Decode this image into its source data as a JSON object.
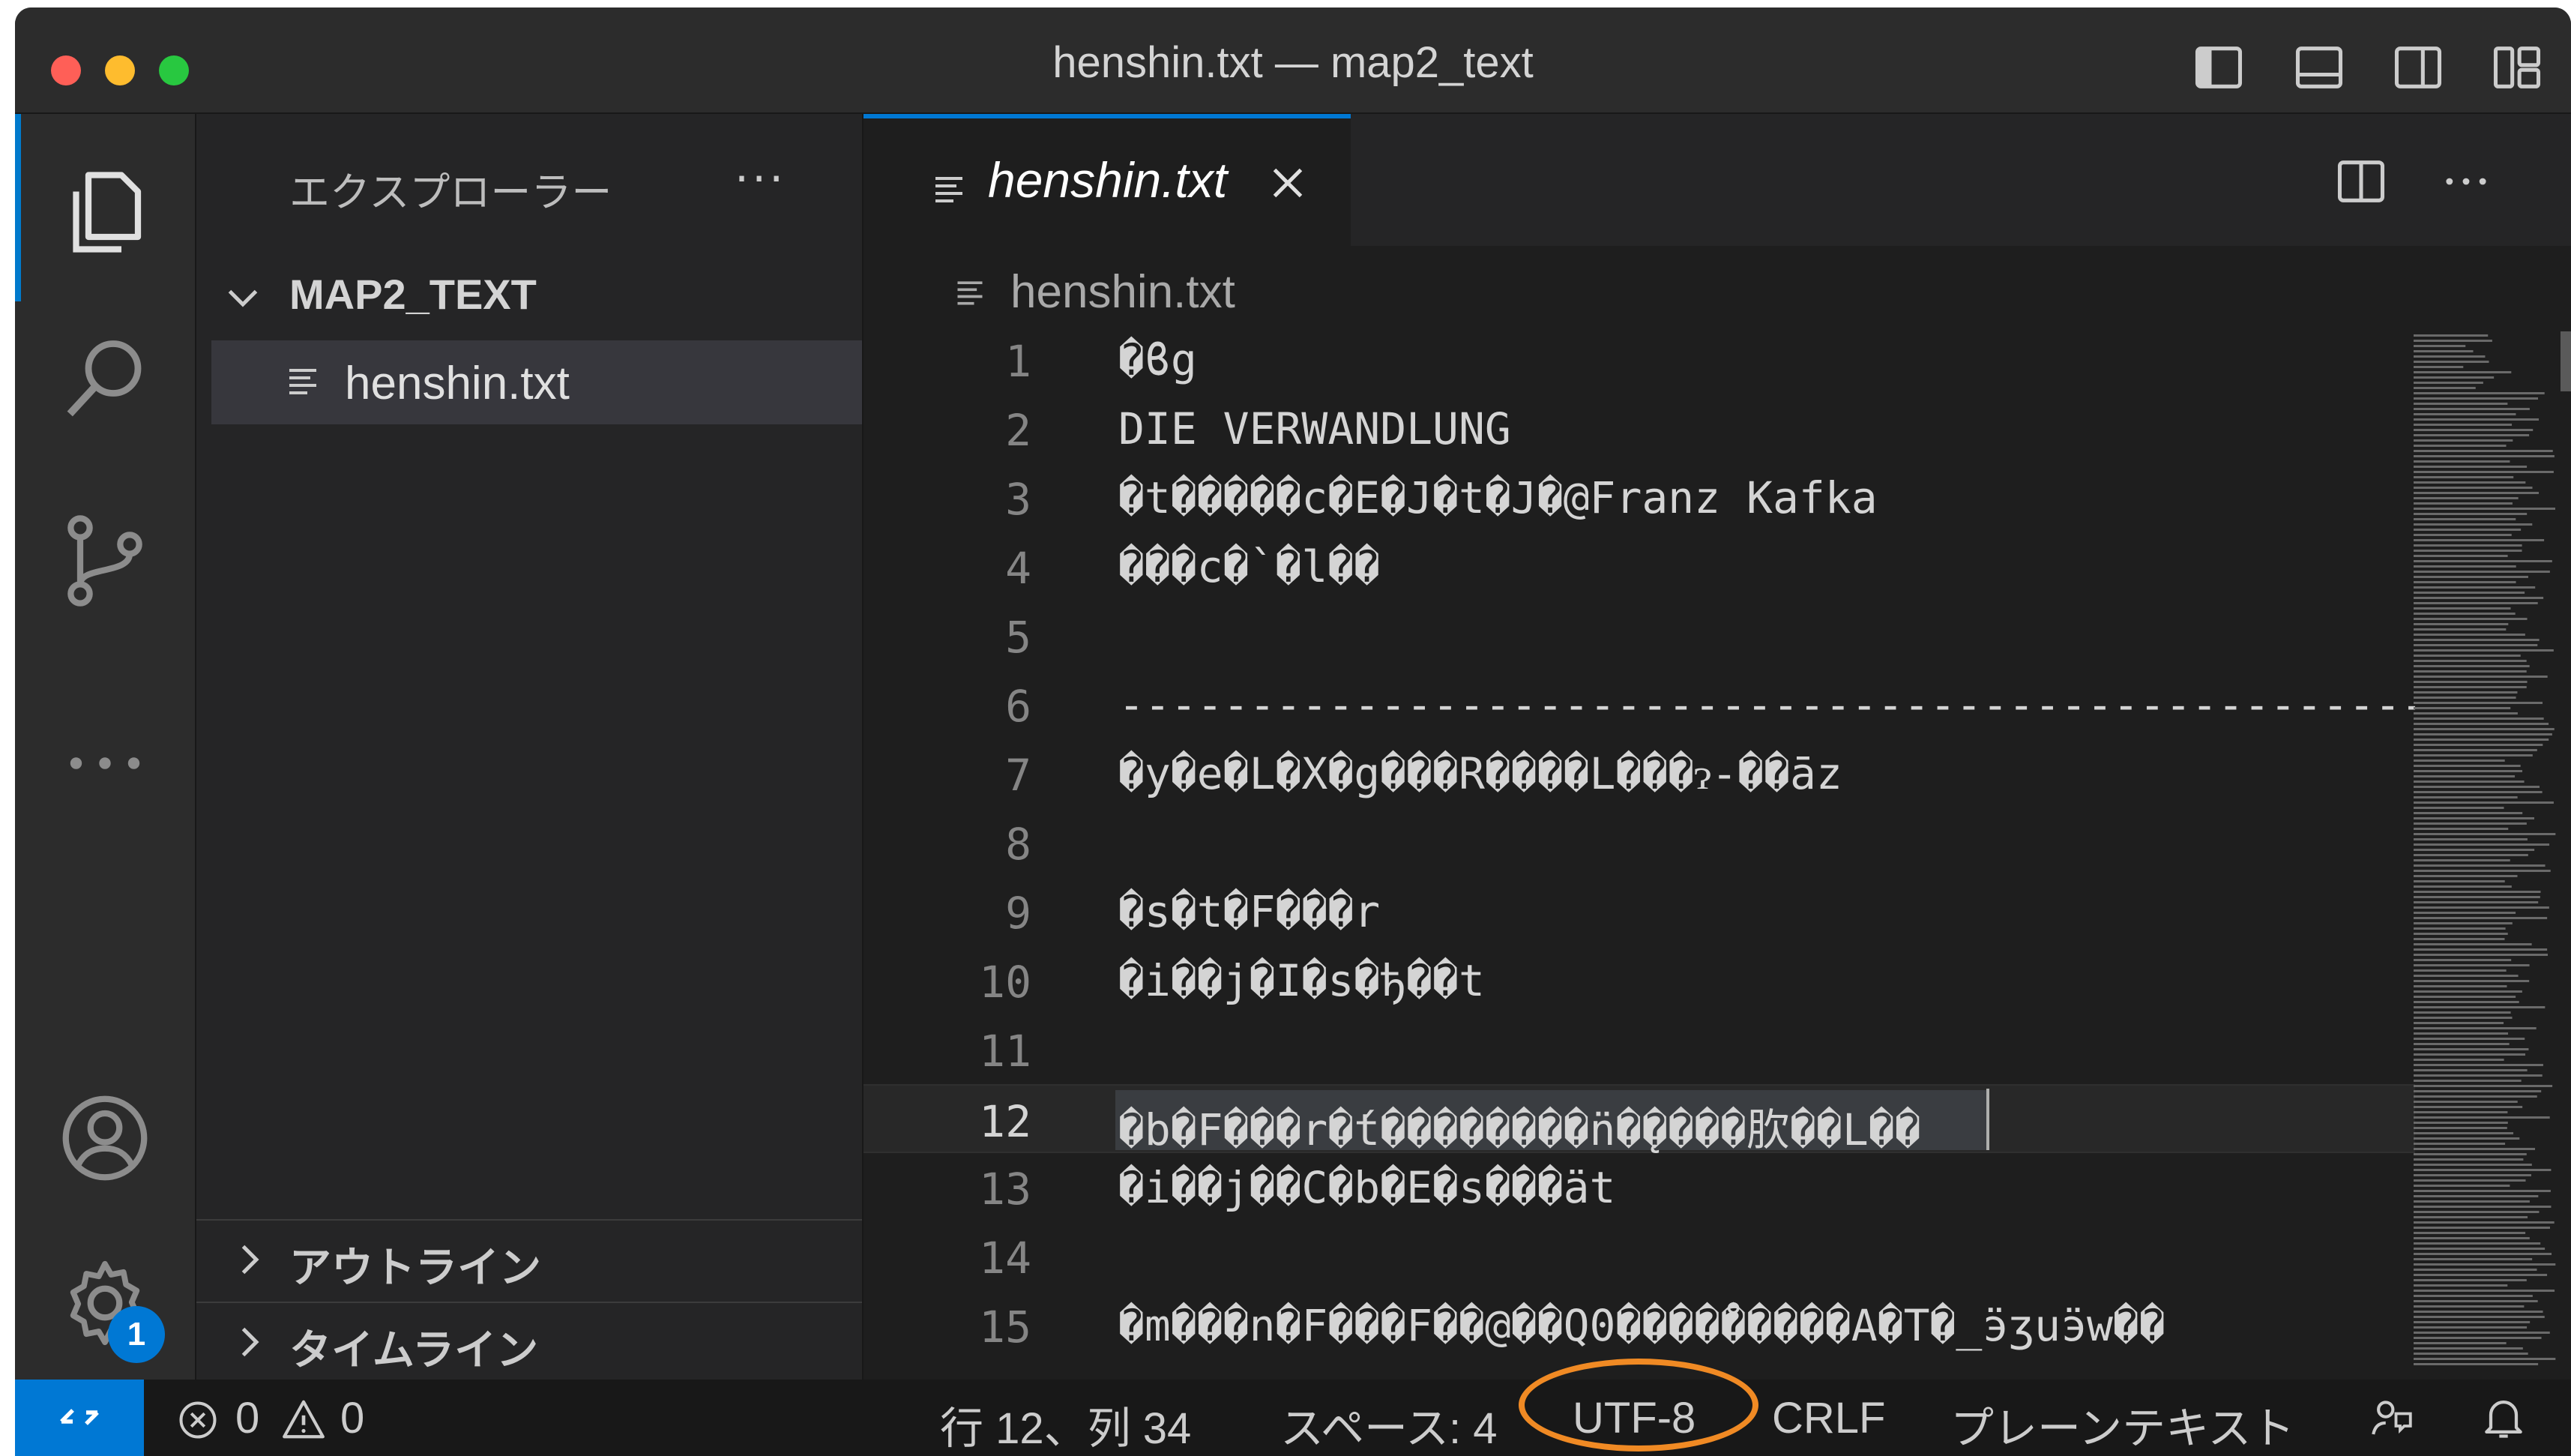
{
  "window": {
    "title": "henshin.txt — map2_text"
  },
  "sidebar": {
    "title": "エクスプローラー",
    "more_label": "···",
    "folder": "MAP2_TEXT",
    "file": "henshin.txt",
    "panels": [
      {
        "label": "アウトライン"
      },
      {
        "label": "タイムライン"
      }
    ]
  },
  "activity": {
    "settings_badge": "1"
  },
  "editor": {
    "tab_label": "henshin.txt",
    "breadcrumb": "henshin.txt",
    "current_line": 12,
    "lines": [
      {
        "n": "1",
        "text": "�ϐg"
      },
      {
        "n": "2",
        "text": "DIE VERWANDLUNG"
      },
      {
        "n": "3",
        "text": "�t�����c�E�J�t�J�@Franz Kafka"
      },
      {
        "n": "4",
        "text": "���c�`�l��"
      },
      {
        "n": "5",
        "text": ""
      },
      {
        "n": "6",
        "text": "-----------------------------------------------------------"
      },
      {
        "n": "7",
        "text": "�y�e�L�X�g���R����L���ɂ-��āz"
      },
      {
        "n": "8",
        "text": ""
      },
      {
        "n": "9",
        "text": "�s�t�F���r"
      },
      {
        "n": "10",
        "text": "�i��j�I�s�ђ��t"
      },
      {
        "n": "11",
        "text": ""
      },
      {
        "n": "12",
        "text": "�b�F���r�́t��������̈n�̨����肷��L��"
      },
      {
        "n": "13",
        "text": "�i��j��C�b�E�s���ät"
      },
      {
        "n": "14",
        "text": ""
      },
      {
        "n": "15",
        "text": "�m���n�F���F��@��Q0����̊�����A�T�_ӭʒuӭw��"
      }
    ]
  },
  "statusbar": {
    "errors": "0",
    "warnings": "0",
    "position": "行 12、列 34",
    "indent": "スペース: 4",
    "encoding": "UTF-8",
    "eol": "CRLF",
    "language": "プレーンテキスト"
  },
  "colors": {
    "accent": "#0078d4",
    "annotation": "#f08a24"
  }
}
